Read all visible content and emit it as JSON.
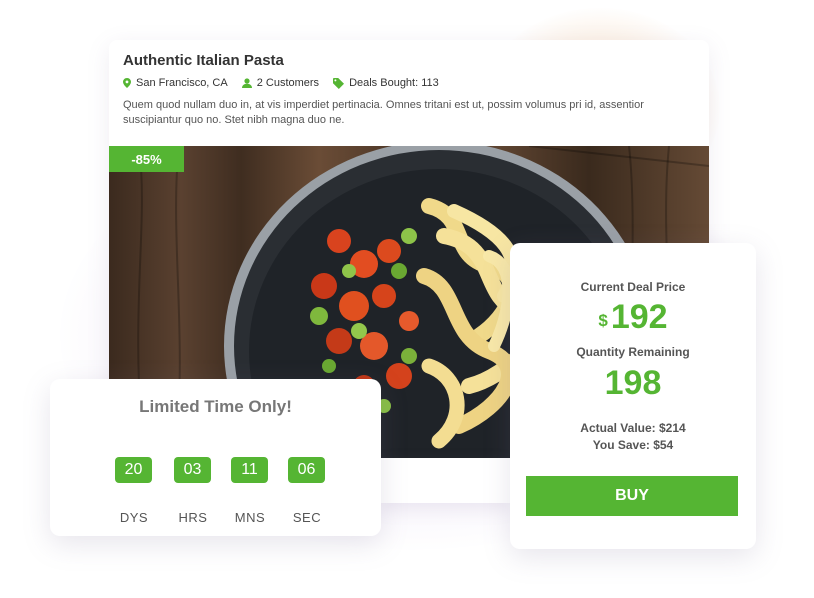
{
  "deal": {
    "title": "Authentic Italian Pasta",
    "location": "San Francisco, CA",
    "customers": "2 Customers",
    "deals_bought": "Deals Bought: 113",
    "description": "Quem quod nullam duo in, at vis imperdiet pertinacia. Omnes tritani est ut, possim volumus pri id, assentior suscipiantur quo no. Stet nibh magna duo ne.",
    "discount": "-85%"
  },
  "timer": {
    "title": "Limited Time Only!",
    "counters": [
      {
        "value": "20",
        "unit": "DYS"
      },
      {
        "value": "03",
        "unit": "HRS"
      },
      {
        "value": "11",
        "unit": "MNS"
      },
      {
        "value": "06",
        "unit": "SEC"
      }
    ]
  },
  "pricing": {
    "current_label": "Current Deal Price",
    "currency": "$",
    "price": "192",
    "qty_label": "Quantity Remaining",
    "qty": "198",
    "actual_value": "Actual Value: $214",
    "you_save": "You Save: $54",
    "buy_label": "BUY"
  },
  "colors": {
    "accent": "#55b533",
    "text": "#333333"
  }
}
